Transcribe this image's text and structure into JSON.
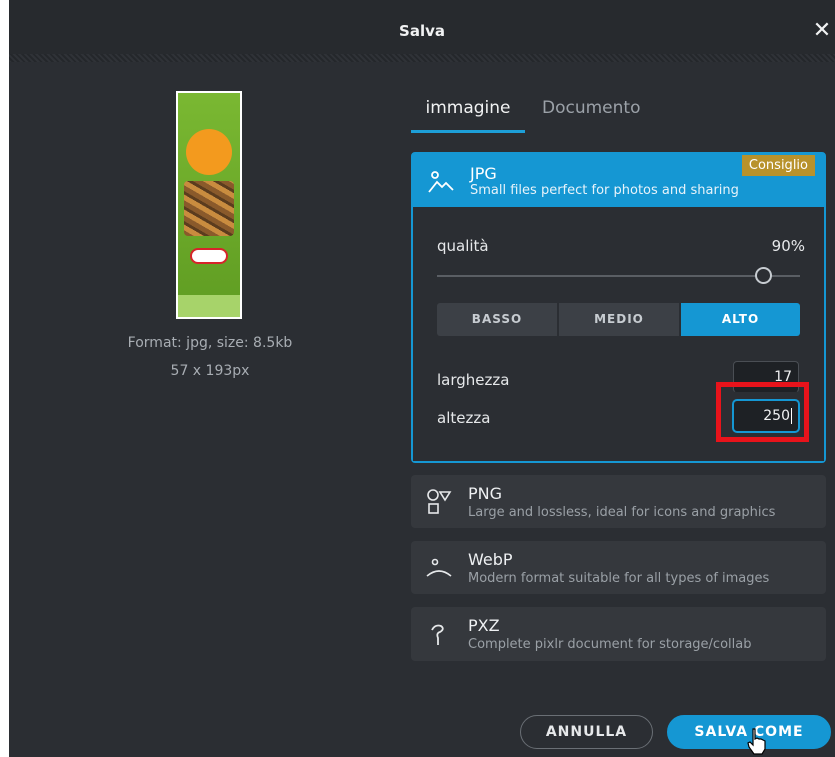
{
  "dialog": {
    "title": "Salva",
    "close_icon": "close-icon"
  },
  "preview": {
    "format_info": "Format: jpg, size: 8.5kb",
    "dimensions": "57 x 193px"
  },
  "tabs": [
    {
      "label": "immagine",
      "active": true
    },
    {
      "label": "Documento",
      "active": false
    }
  ],
  "formats": {
    "jpg": {
      "name": "JPG",
      "description": "Small files perfect for photos and sharing",
      "badge": "Consiglio",
      "icon": "image-mountain-icon",
      "quality_label": "qualità",
      "quality_value": "90%",
      "quality_fraction": 0.9,
      "presets": [
        "BASSO",
        "MEDIO",
        "ALTO"
      ],
      "selected_preset": "ALTO",
      "width_label": "larghezza",
      "width_value": "17",
      "height_label": "altezza",
      "height_value": "250"
    },
    "png": {
      "name": "PNG",
      "description": "Large and lossless, ideal for icons and graphics",
      "icon": "shapes-icon"
    },
    "webp": {
      "name": "WebP",
      "description": "Modern format suitable for all types of images",
      "icon": "webp-icon"
    },
    "pxz": {
      "name": "PXZ",
      "description": "Complete pixlr document for storage/collab",
      "icon": "pxz-icon"
    }
  },
  "buttons": {
    "cancel": "ANNULLA",
    "save_as": "SALVA COME"
  },
  "colors": {
    "accent": "#1597d3",
    "badge": "#b8922c",
    "highlight": "#e8131b",
    "background": "#2b2e33"
  }
}
